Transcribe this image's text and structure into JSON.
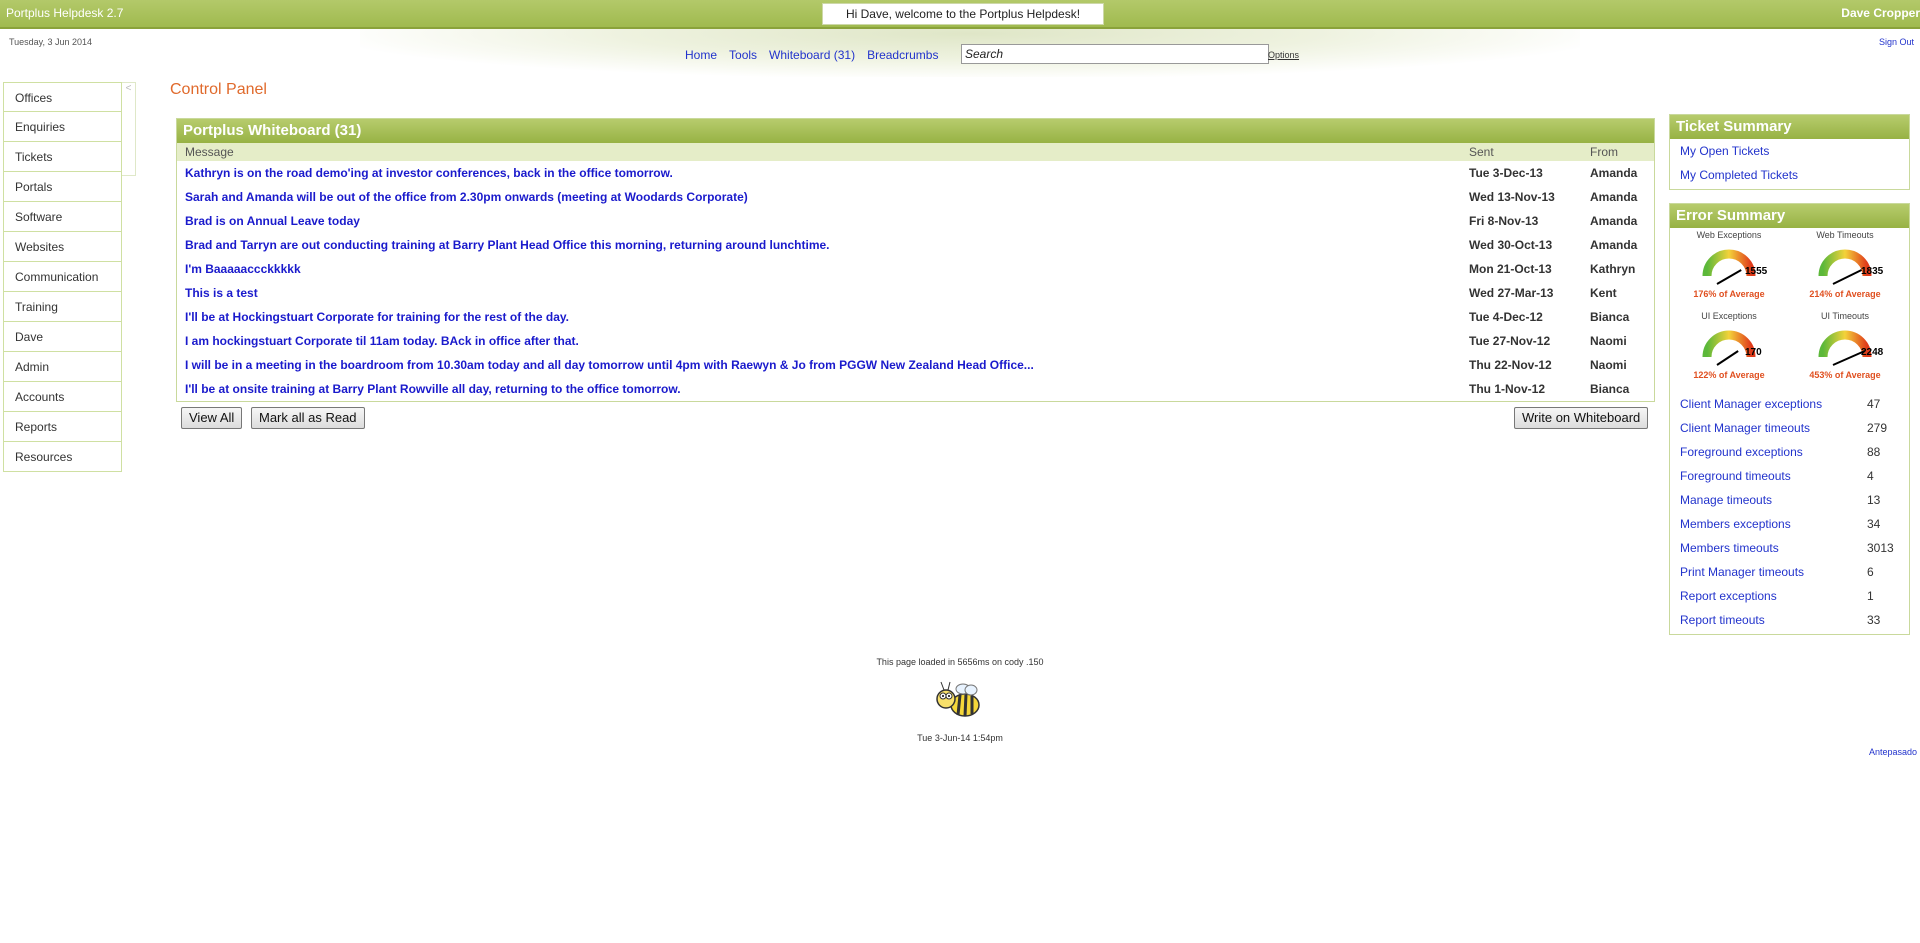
{
  "app": {
    "title": "Portplus Helpdesk 2.7",
    "welcome": "Hi Dave, welcome to the Portplus Helpdesk!",
    "user": "Dave Cropper"
  },
  "header": {
    "date": "Tuesday, 3 Jun 2014",
    "sign_out": "Sign Out",
    "nav": [
      "Home",
      "Tools",
      "Whiteboard (31)",
      "Breadcrumbs"
    ],
    "search_value": "Search",
    "options": "Options"
  },
  "sidebar": {
    "items": [
      "Offices",
      "Enquiries",
      "Tickets",
      "Portals",
      "Software",
      "Websites",
      "Communication",
      "Training",
      "Dave",
      "Admin",
      "Accounts",
      "Reports",
      "Resources"
    ],
    "collapse_icon": "<"
  },
  "page_title": "Control Panel",
  "whiteboard": {
    "title": "Portplus Whiteboard (31)",
    "columns": [
      "Message",
      "Sent",
      "From"
    ],
    "rows": [
      {
        "message": "Kathryn is on the road demo'ing at investor conferences, back in the office tomorrow.",
        "sent": "Tue 3-Dec-13",
        "from": "Amanda"
      },
      {
        "message": "Sarah and Amanda will be out of the office from 2.30pm onwards (meeting at Woodards Corporate)",
        "sent": "Wed 13-Nov-13",
        "from": "Amanda"
      },
      {
        "message": "Brad is on Annual Leave today",
        "sent": "Fri 8-Nov-13",
        "from": "Amanda"
      },
      {
        "message": "Brad and Tarryn are out conducting training at Barry Plant Head Office this morning, returning around lunchtime.",
        "sent": "Wed 30-Oct-13",
        "from": "Amanda"
      },
      {
        "message": "I'm Baaaaaccckkkkk",
        "sent": "Mon 21-Oct-13",
        "from": "Kathryn"
      },
      {
        "message": "This is a test",
        "sent": "Wed 27-Mar-13",
        "from": "Kent"
      },
      {
        "message": "I'll be at Hockingstuart Corporate for training for the rest of the day.",
        "sent": "Tue 4-Dec-12",
        "from": "Bianca"
      },
      {
        "message": "I am hockingstuart Corporate til 11am today. BAck in office after that.",
        "sent": "Tue 27-Nov-12",
        "from": "Naomi"
      },
      {
        "message": "I will be in a meeting in the boardroom from 10.30am today and all day tomorrow until 4pm with Raewyn & Jo from PGGW New Zealand Head Office...",
        "sent": "Thu 22-Nov-12",
        "from": "Naomi"
      },
      {
        "message": "I'll be at onsite training at Barry Plant Rowville all day, returning to the office tomorrow.",
        "sent": "Thu 1-Nov-12",
        "from": "Bianca"
      }
    ],
    "view_all": "View All",
    "mark_read": "Mark all as Read",
    "write": "Write on Whiteboard"
  },
  "ticket_summary": {
    "title": "Ticket Summary",
    "links": [
      "My Open Tickets",
      "My Completed Tickets"
    ]
  },
  "error_summary": {
    "title": "Error Summary",
    "gauges": [
      {
        "title": "Web Exceptions",
        "value": "1555",
        "pct": "176% of Average",
        "level": 0.74
      },
      {
        "title": "Web Timeouts",
        "value": "1835",
        "pct": "214% of Average",
        "level": 0.8
      },
      {
        "title": "UI Exceptions",
        "value": "170",
        "pct": "122% of Average",
        "level": 0.7
      },
      {
        "title": "UI Timeouts",
        "value": "2248",
        "pct": "453% of Average",
        "level": 0.85
      }
    ],
    "rows": [
      {
        "name": "Client Manager exceptions",
        "value": "47"
      },
      {
        "name": "Client Manager timeouts",
        "value": "279"
      },
      {
        "name": "Foreground exceptions",
        "value": "88"
      },
      {
        "name": "Foreground timeouts",
        "value": "4"
      },
      {
        "name": "Manage timeouts",
        "value": "13"
      },
      {
        "name": "Members exceptions",
        "value": "34"
      },
      {
        "name": "Members timeouts",
        "value": "3013"
      },
      {
        "name": "Print Manager timeouts",
        "value": "6"
      },
      {
        "name": "Report exceptions",
        "value": "1"
      },
      {
        "name": "Report timeouts",
        "value": "33"
      }
    ]
  },
  "footer": {
    "load": "This page loaded in 5656ms on cody .150",
    "time": "Tue 3-Jun-14 1:54pm",
    "link": "Antepasado"
  }
}
